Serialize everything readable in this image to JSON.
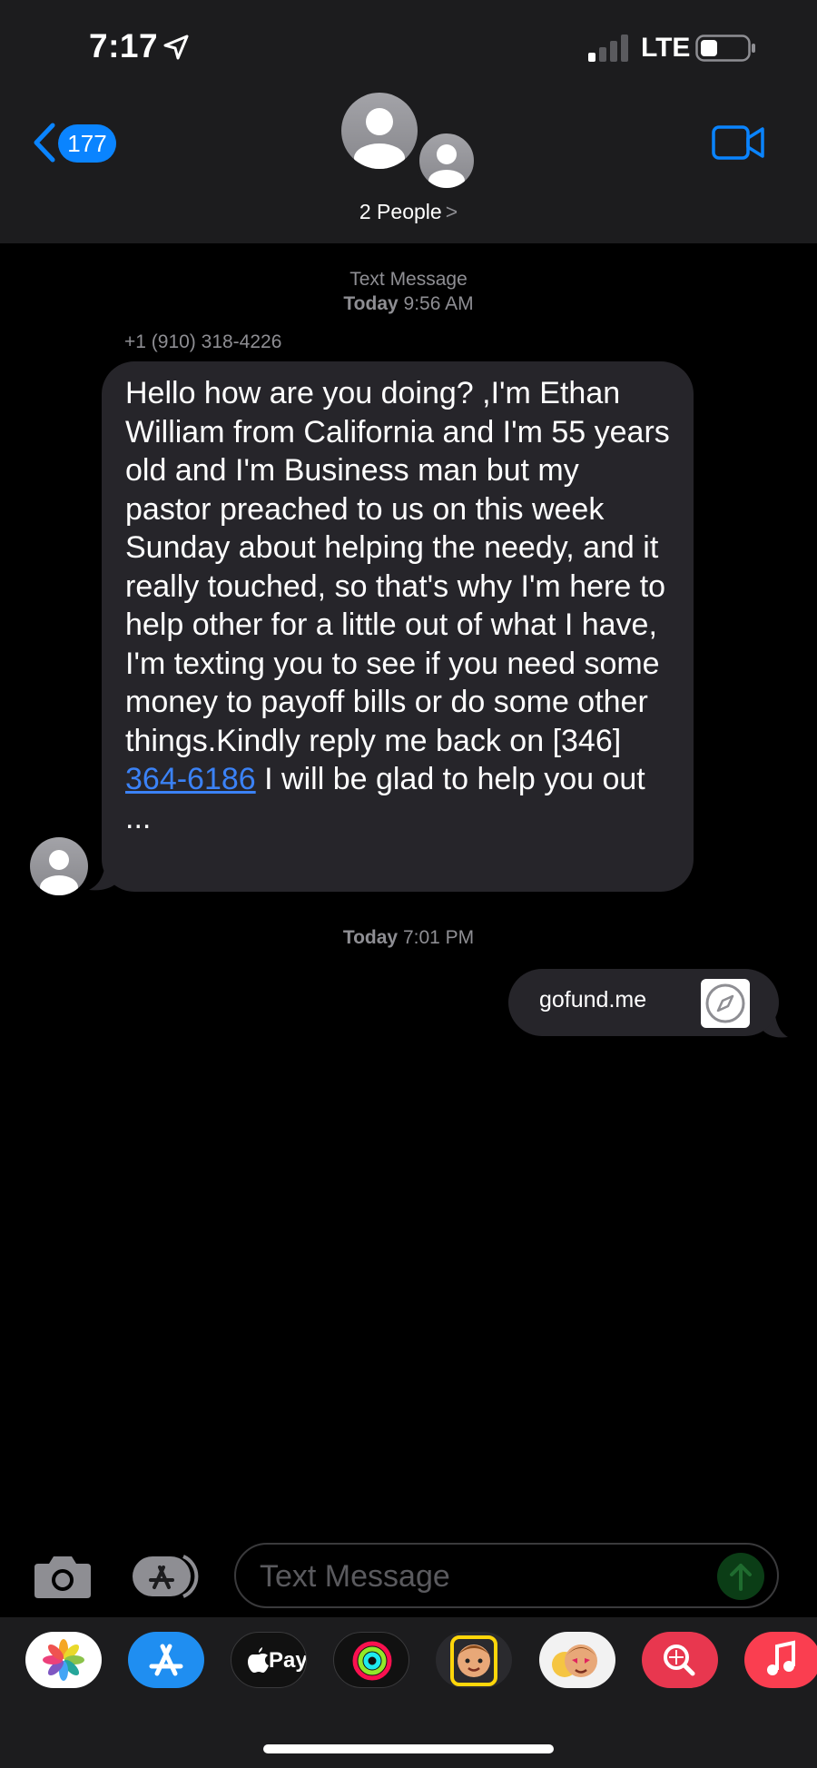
{
  "status_bar": {
    "time": "7:17",
    "network": "LTE"
  },
  "nav": {
    "back_count": "177",
    "people_label": "2 People",
    "people_chevron": ">"
  },
  "conversation": {
    "header_label": "Text Message",
    "first_timestamp": {
      "day": "Today",
      "time": "9:56 AM"
    },
    "sender_number": "+1 (910) 318-4226",
    "incoming_message": {
      "text_before_link": "Hello how  are you doing? ,I'm Ethan William from California and I'm 55 years  old and I'm Business man but my pastor preached to us on this week Sunday about helping the needy, and it really touched, so that's why I'm here to help other for a little out of what I have, I'm texting you to see if you need some money to payoff bills or do some other things.Kindly reply me back on [346] ",
      "phone_link": "364-6186",
      "text_after_link": " I  will be glad to help you out ..."
    },
    "second_timestamp": {
      "day": "Today",
      "time": "7:01 PM"
    },
    "outgoing_link_preview": {
      "text": "gofund.me",
      "icon": "compass-icon"
    }
  },
  "composer": {
    "placeholder": "Text Message"
  },
  "app_drawer": {
    "apps": [
      {
        "name": "photos",
        "icon": "photos-icon"
      },
      {
        "name": "app-store",
        "icon": "app-store-icon"
      },
      {
        "name": "apple-pay",
        "icon": "apple-pay-icon",
        "label": "Pay"
      },
      {
        "name": "activity",
        "icon": "activity-rings-icon"
      },
      {
        "name": "memoji",
        "icon": "memoji-icon"
      },
      {
        "name": "memoji-stickers",
        "icon": "memoji-stickers-icon"
      },
      {
        "name": "images-search",
        "icon": "images-search-icon"
      },
      {
        "name": "music",
        "icon": "music-icon"
      }
    ]
  },
  "colors": {
    "accent_blue": "#0a84ff",
    "header_bg": "#1c1c1e",
    "bubble_bg": "#26252a",
    "meta_text": "#8e8e93",
    "link_blue": "#3b82f6"
  }
}
